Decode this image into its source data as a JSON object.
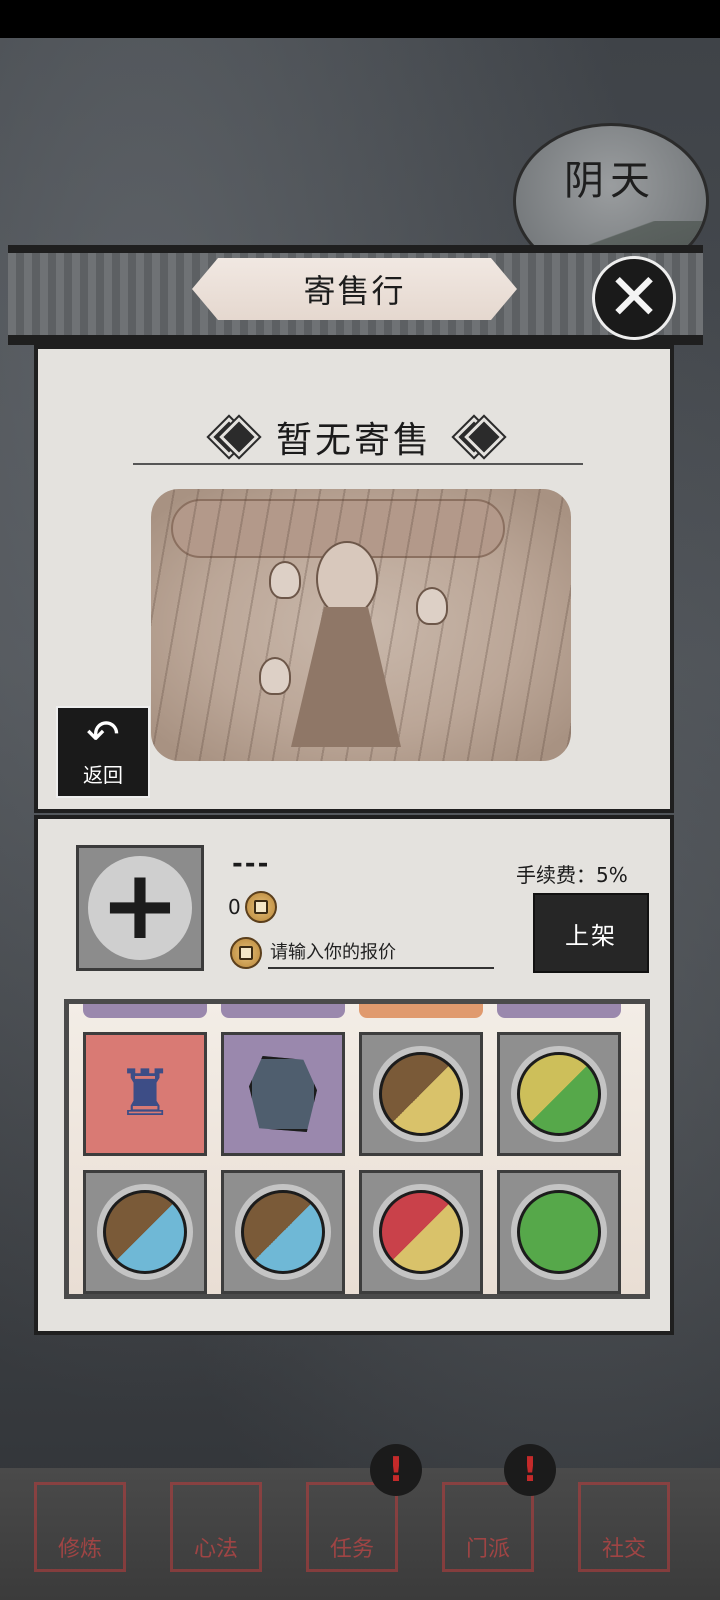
{
  "weather": {
    "label": "阴天"
  },
  "dialog": {
    "title": "寄售行",
    "close_icon": "close-icon",
    "empty_title": "暂无寄售",
    "back_button": {
      "label": "返回",
      "icon": "back-arrow-icon"
    }
  },
  "listing": {
    "item_name": "---",
    "amount": "0",
    "price_placeholder": "请输入你的报价",
    "fee_text": "手续费：5%",
    "list_button": "上架"
  },
  "inventory": {
    "items": [
      {
        "name": "censer",
        "frame": "red"
      },
      {
        "name": "stone",
        "frame": "purple"
      },
      {
        "name": "orb",
        "frame": "gray",
        "colors": [
          "#7a5a38",
          "#d9c26a"
        ]
      },
      {
        "name": "orb",
        "frame": "gray",
        "colors": [
          "#cdbf5a",
          "#56a84a"
        ]
      },
      {
        "name": "orb",
        "frame": "gray",
        "colors": [
          "#7a5a38",
          "#6fb8d6"
        ]
      },
      {
        "name": "orb",
        "frame": "gray",
        "colors": [
          "#7a5a38",
          "#6fb8d6"
        ]
      },
      {
        "name": "orb",
        "frame": "gray",
        "colors": [
          "#c9414a",
          "#d9c26a"
        ]
      },
      {
        "name": "orb",
        "frame": "gray",
        "colors": [
          "#56a84a",
          "#56a84a"
        ]
      }
    ]
  },
  "nav": {
    "items": [
      "修炼",
      "心法",
      "任务",
      "门派",
      "社交"
    ]
  },
  "colors": {
    "panel": "#e4e2de",
    "ink": "#1f1f1f",
    "nav_red": "#c84646"
  }
}
